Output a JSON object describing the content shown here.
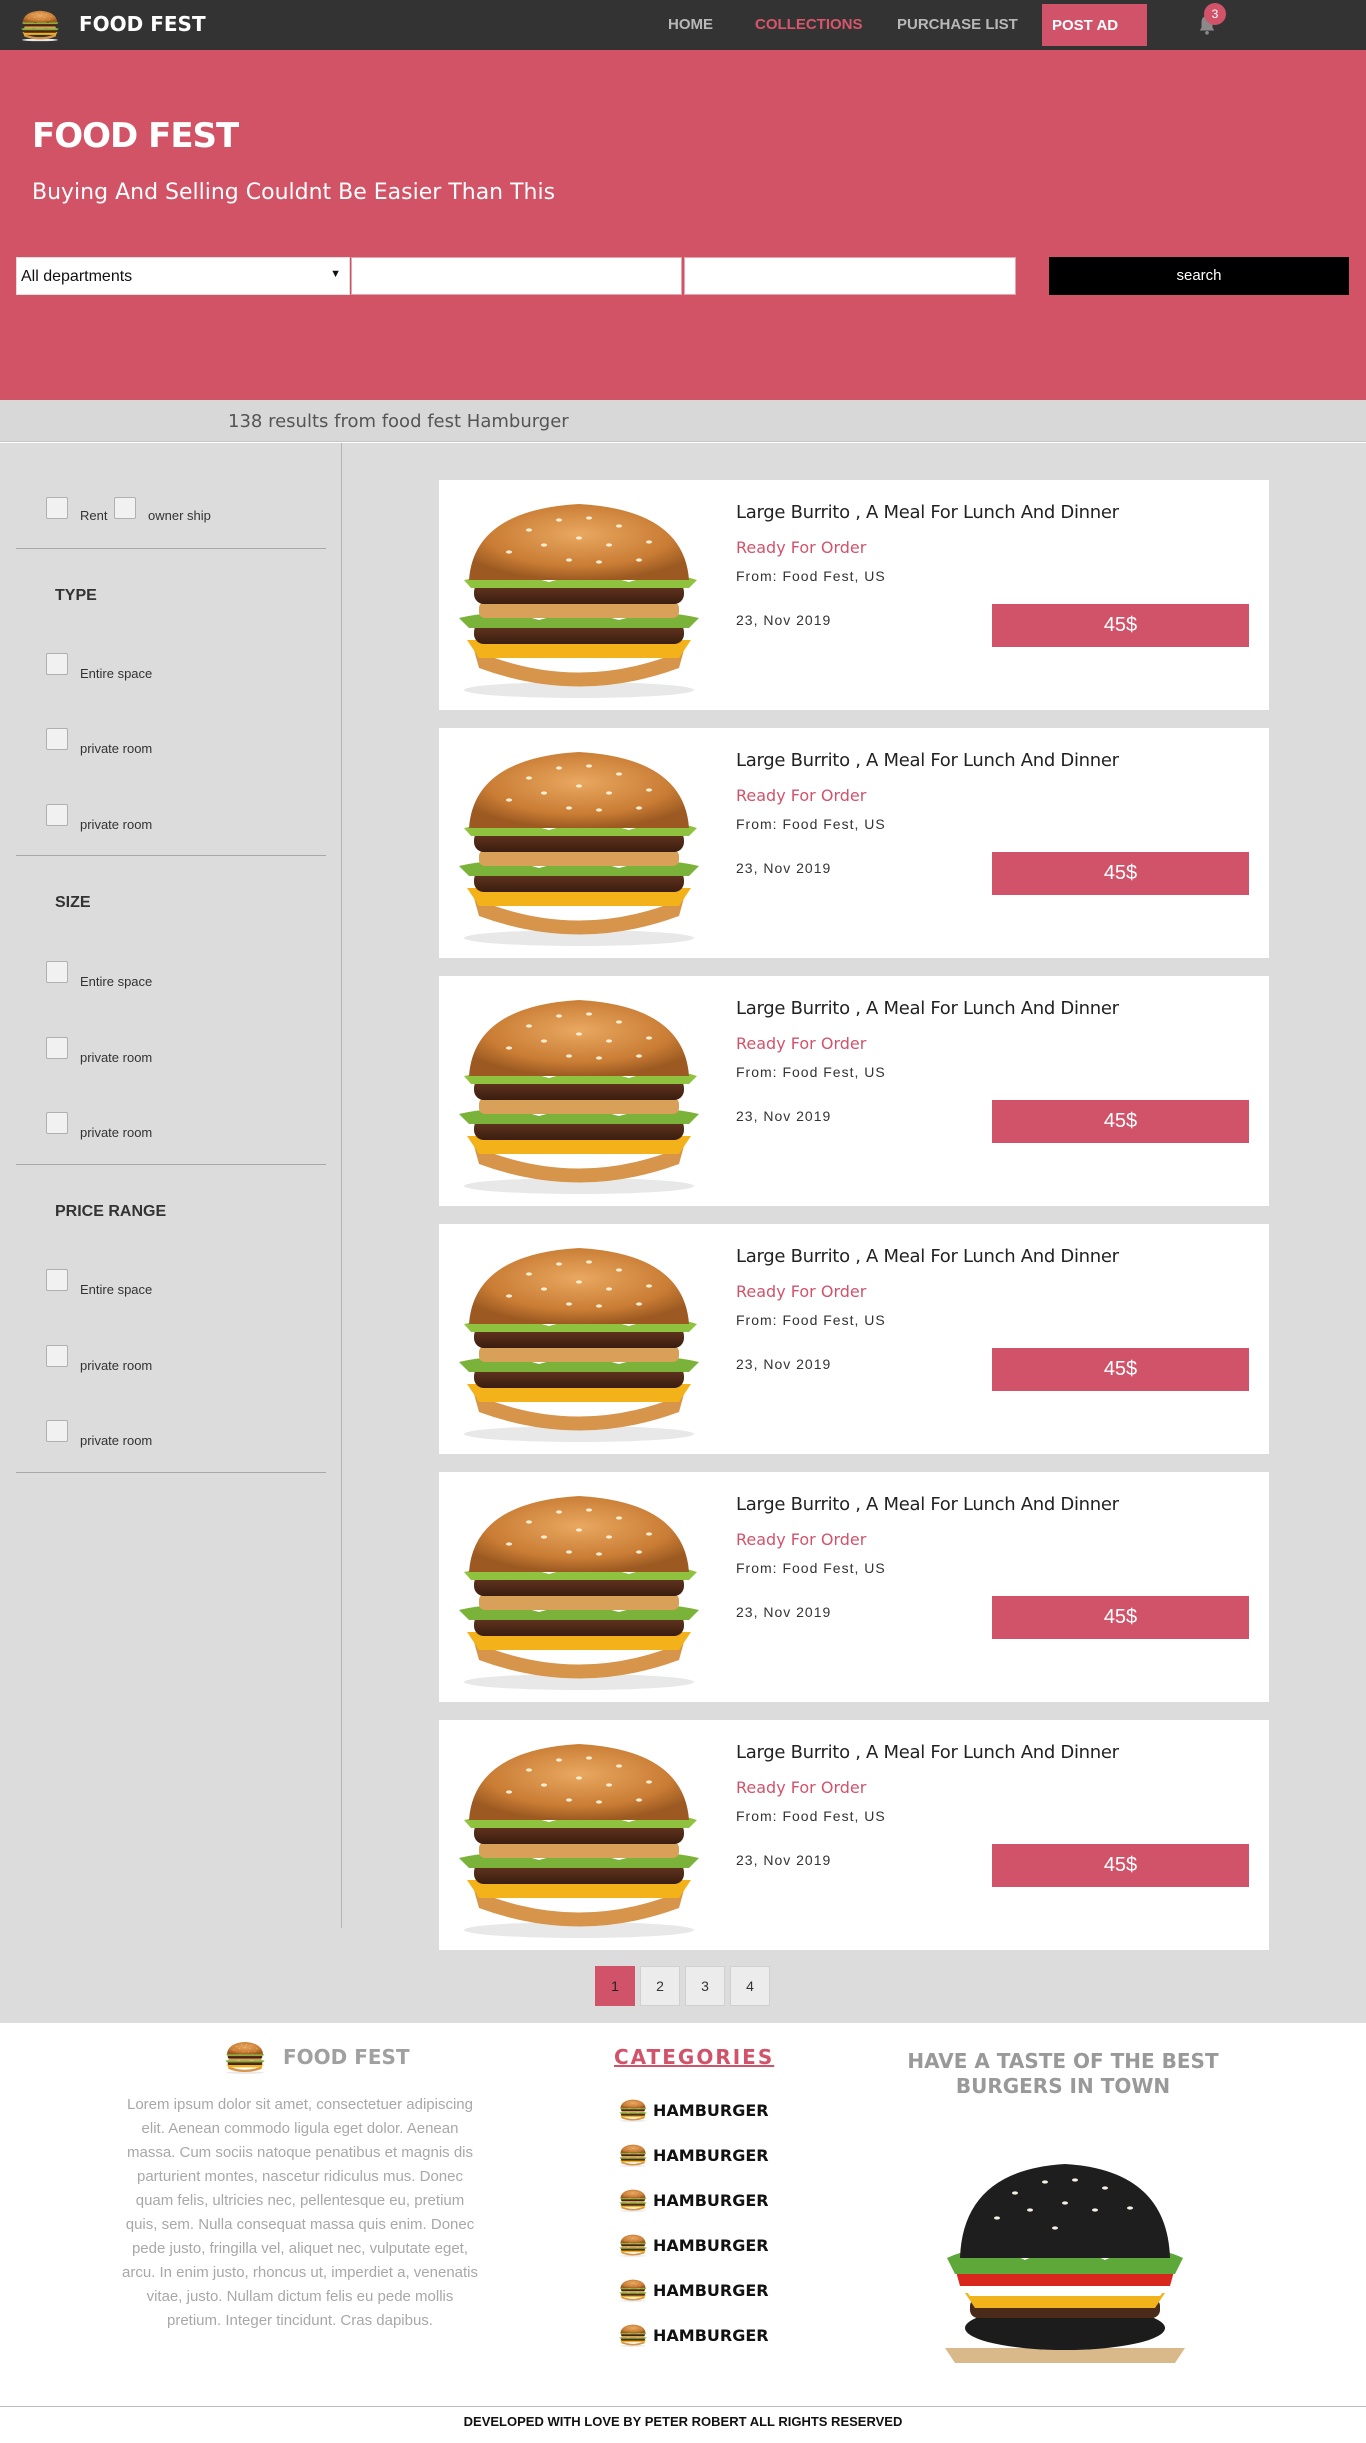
{
  "nav": {
    "brand": "FOOD FEST",
    "items": [
      {
        "label": "HOME",
        "active": false
      },
      {
        "label": "COLLECTIONS",
        "active": true
      },
      {
        "label": "PURCHASE LIST",
        "active": false
      }
    ],
    "post_ad": "POST AD",
    "notification_count": "3",
    "accent": "#d1536a"
  },
  "hero": {
    "title": "FOOD FEST",
    "tagline": "Buying And Selling Couldnt Be Easier Than This",
    "department_selected": "All departments",
    "search_label": "search"
  },
  "results": {
    "summary": "138 results from food fest Hamburger"
  },
  "filters": {
    "listing_type": [
      {
        "label": "Rent"
      },
      {
        "label": "owner ship"
      }
    ],
    "sections": [
      {
        "title": "TYPE",
        "options": [
          "Entire space",
          "private room",
          "private room"
        ]
      },
      {
        "title": "SIZE",
        "options": [
          "Entire space",
          "private room",
          "private room"
        ]
      },
      {
        "title": "PRICE RANGE",
        "options": [
          "Entire space",
          "private room",
          "private room"
        ]
      }
    ]
  },
  "listings": [
    {
      "title": "Large Burrito , A Meal For Lunch And Dinner",
      "status": "Ready For Order",
      "origin": "From: Food Fest, US",
      "date": "23, Nov 2019",
      "price": "45$"
    },
    {
      "title": "Large Burrito , A Meal For Lunch And Dinner",
      "status": "Ready For Order",
      "origin": "From: Food Fest, US",
      "date": "23, Nov 2019",
      "price": "45$"
    },
    {
      "title": "Large Burrito , A Meal For Lunch And Dinner",
      "status": "Ready For Order",
      "origin": "From: Food Fest, US",
      "date": "23, Nov 2019",
      "price": "45$"
    },
    {
      "title": "Large Burrito , A Meal For Lunch And Dinner",
      "status": "Ready For Order",
      "origin": "From: Food Fest, US",
      "date": "23, Nov 2019",
      "price": "45$"
    },
    {
      "title": "Large Burrito , A Meal For Lunch And Dinner",
      "status": "Ready For Order",
      "origin": "From: Food Fest, US",
      "date": "23, Nov 2019",
      "price": "45$"
    },
    {
      "title": "Large Burrito , A Meal For Lunch And Dinner",
      "status": "Ready For Order",
      "origin": "From: Food Fest, US",
      "date": "23, Nov 2019",
      "price": "45$"
    }
  ],
  "pagination": {
    "pages": [
      "1",
      "2",
      "3",
      "4"
    ],
    "current": "1"
  },
  "footer": {
    "brand": "FOOD FEST",
    "about": "Lorem ipsum dolor sit amet, consectetuer adipiscing elit. Aenean commodo ligula eget dolor. Aenean massa. Cum sociis natoque penatibus et magnis dis parturient montes, nascetur ridiculus mus. Donec quam felis, ultricies nec, pellentesque eu, pretium quis, sem. Nulla consequat massa quis enim. Donec pede justo, fringilla vel, aliquet nec, vulputate eget, arcu. In enim justo, rhoncus ut, imperdiet a, venenatis vitae, justo. Nullam dictum felis eu pede mollis pretium. Integer tincidunt. Cras dapibus.",
    "categories_title": "CATEGORIES",
    "categories": [
      "HAMBURGER",
      "HAMBURGER",
      "HAMBURGER",
      "HAMBURGER",
      "HAMBURGER",
      "HAMBURGER"
    ],
    "promo": "HAVE A TASTE OF THE BEST BURGERS IN TOWN",
    "copyright": "DEVELOPED WITH LOVE BY PETER ROBERT ALL RIGHTS RESERVED"
  }
}
